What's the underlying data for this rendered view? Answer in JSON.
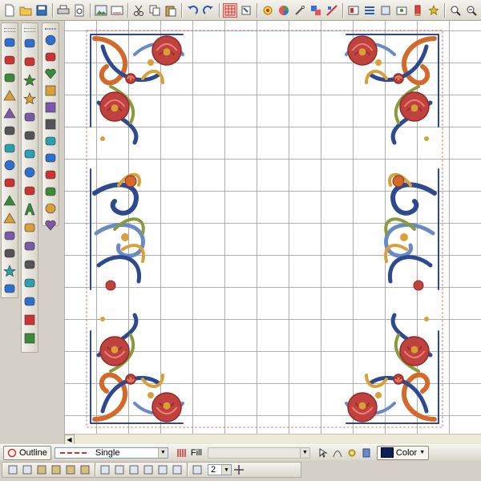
{
  "toolbar": {
    "icons": [
      "new-file-icon",
      "open-folder-icon",
      "save-icon",
      "print-icon",
      "print-preview-icon",
      "image-icon",
      "cut-icon",
      "copy-icon",
      "paste-icon",
      "undo-icon",
      "redo-icon",
      "grid-icon",
      "select-icon",
      "stitch-icon",
      "color-wheel-icon",
      "needle-icon",
      "color-swap-icon",
      "hoop-icon",
      "layers-icon",
      "object-icon",
      "align-icon",
      "picture-icon",
      "thread-icon",
      "stars-icon",
      "zoom-in-icon",
      "zoom-out-icon",
      "zoom-fit-icon"
    ]
  },
  "palette": {
    "col1": [
      "select-arrow-icon",
      "magic-wand-icon",
      "node-edit-icon",
      "triangle-icon",
      "flag-icon",
      "rotate-icon",
      "resize-icon",
      "circle-link-icon",
      "stack-icon",
      "mountain-icon",
      "pyramid-icon",
      "flower-icon",
      "rectangle-icon",
      "gear-star-icon",
      "paint-drops-icon"
    ],
    "col2": [
      "swan-icon",
      "sparkle-icon",
      "star-outline-icon",
      "star-fill-icon",
      "wave-icon",
      "stitch-path-icon",
      "zigzag-icon",
      "circle-icon",
      "square-icon",
      "letter-a-icon",
      "diamond-icon",
      "redwork-icon",
      "arrows-icon",
      "cloud-icon",
      "frame-icon",
      "cross-grid-icon",
      "domino-icon"
    ],
    "col3": [
      "knot-icon",
      "x-shape-icon",
      "heart-cluster-icon",
      "dot-grid-icon",
      "dot-grid-red-icon",
      "blue-grid-icon",
      "blob-icon",
      "leaf-icon",
      "feather-icon",
      "rose-icon",
      "sphere-icon",
      "heart-icon"
    ]
  },
  "outline_bar": {
    "outline_label": "Outline",
    "line_style": "Single",
    "fill_label": "Fill",
    "fill_value": "",
    "color_label": "Color",
    "color_value": "#0a1f5c"
  },
  "bottom_bar": {
    "icons": [
      "group-icon",
      "ungroup-icon",
      "lock-icon",
      "unlock-icon",
      "lock-alt-icon",
      "unlock-alt-icon",
      "align-left-icon",
      "align-center-icon",
      "align-right-icon",
      "align-top-icon",
      "align-middle-icon",
      "align-bottom-icon",
      "distribute-icon"
    ],
    "spacing_value": "2"
  },
  "colors": {
    "rose": "#c0423e",
    "rose_dark": "#8e2a2a",
    "blue": "#2e4a8f",
    "blue_light": "#6a8ac4",
    "gold": "#d9a03a",
    "green": "#8a9a3c",
    "orange": "#d36a2c",
    "teal": "#3d8a7a"
  }
}
